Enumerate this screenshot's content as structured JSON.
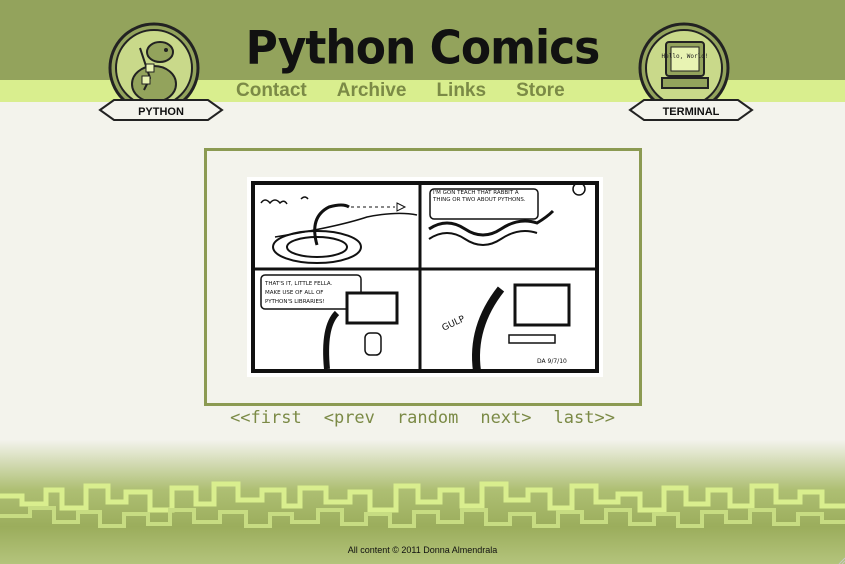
{
  "site": {
    "title": "Python Comics"
  },
  "nav": {
    "items": [
      {
        "label": "Contact"
      },
      {
        "label": "Archive"
      },
      {
        "label": "Links"
      },
      {
        "label": "Store"
      }
    ]
  },
  "badges": {
    "left_label": "PYTHON",
    "right_label": "TERMINAL",
    "right_screen_text": "Hello, World!"
  },
  "comic": {
    "panel1_text": "",
    "panel2_text": "I'M GON TEACH THAT RABBIT A THING OR TWO ABOUT PYTHONS.",
    "panel3_text_line1": "THAT'S IT, LITTLE FELLA.",
    "panel3_text_line2": "MAKE USE OF ALL OF",
    "panel3_text_line3": "PYTHON'S LIBRARIES!",
    "panel4_sfx": "GULP",
    "signature": "DA 9/7/10"
  },
  "comic_nav": {
    "first": "<<first",
    "prev": "<prev",
    "random": "random",
    "next": "next>",
    "last": "last>>"
  },
  "footer": {
    "copyright": "All content © 2011 Donna Almendrala"
  },
  "colors": {
    "header": "#93a35c",
    "nav_strip": "#d9ee8e",
    "link": "#7b8a46",
    "background": "#f3f3ec"
  }
}
